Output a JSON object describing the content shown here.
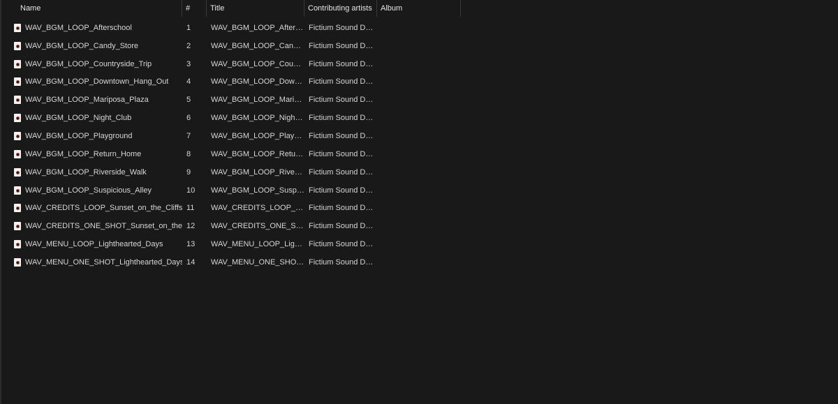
{
  "columns": {
    "name": "Name",
    "num": "#",
    "title": "Title",
    "artist": "Contributing artists",
    "album": "Album"
  },
  "sort_icon": "chevron-up-icon",
  "file_icon": "audio-file-icon",
  "rows": [
    {
      "name": "WAV_BGM_LOOP_Afterschool",
      "num": "1",
      "title": "WAV_BGM_LOOP_Afterschool",
      "artist": "Fictium Sound Design",
      "album": ""
    },
    {
      "name": "WAV_BGM_LOOP_Candy_Store",
      "num": "2",
      "title": "WAV_BGM_LOOP_Candy_Store",
      "artist": "Fictium Sound Design",
      "album": ""
    },
    {
      "name": "WAV_BGM_LOOP_Countryside_Trip",
      "num": "3",
      "title": "WAV_BGM_LOOP_Countryside_Trip",
      "artist": "Fictium Sound Design",
      "album": ""
    },
    {
      "name": "WAV_BGM_LOOP_Downtown_Hang_Out",
      "num": "4",
      "title": "WAV_BGM_LOOP_Downtown_Hang_Out",
      "artist": "Fictium Sound Design",
      "album": ""
    },
    {
      "name": "WAV_BGM_LOOP_Mariposa_Plaza",
      "num": "5",
      "title": "WAV_BGM_LOOP_Mariposa_Plaza",
      "artist": "Fictium Sound Design",
      "album": ""
    },
    {
      "name": "WAV_BGM_LOOP_Night_Club",
      "num": "6",
      "title": "WAV_BGM_LOOP_Night_Club",
      "artist": "Fictium Sound Design",
      "album": ""
    },
    {
      "name": "WAV_BGM_LOOP_Playground",
      "num": "7",
      "title": "WAV_BGM_LOOP_Playground",
      "artist": "Fictium Sound Design",
      "album": ""
    },
    {
      "name": "WAV_BGM_LOOP_Return_Home",
      "num": "8",
      "title": "WAV_BGM_LOOP_Return_Home",
      "artist": "Fictium Sound Design",
      "album": ""
    },
    {
      "name": "WAV_BGM_LOOP_Riverside_Walk",
      "num": "9",
      "title": "WAV_BGM_LOOP_Riverside_Walk",
      "artist": "Fictium Sound Design",
      "album": ""
    },
    {
      "name": "WAV_BGM_LOOP_Suspicious_Alley",
      "num": "10",
      "title": "WAV_BGM_LOOP_Suspicious_Alley",
      "artist": "Fictium Sound Design",
      "album": ""
    },
    {
      "name": "WAV_CREDITS_LOOP_Sunset_on_the_Cliffs",
      "num": "11",
      "title": "WAV_CREDITS_LOOP_Sunset_on_the_Cliffs",
      "artist": "Fictium Sound Design",
      "album": ""
    },
    {
      "name": "WAV_CREDITS_ONE_SHOT_Sunset_on_the_Cliffs",
      "num": "12",
      "title": "WAV_CREDITS_ONE_SHOT_Sunset_on_the_Cliffs",
      "artist": "Fictium Sound Design",
      "album": ""
    },
    {
      "name": "WAV_MENU_LOOP_Lighthearted_Days",
      "num": "13",
      "title": "WAV_MENU_LOOP_Lighthearted_Days",
      "artist": "Fictium Sound Design",
      "album": ""
    },
    {
      "name": "WAV_MENU_ONE_SHOT_Lighthearted_Days",
      "num": "14",
      "title": "WAV_MENU_ONE_SHOT_Lighthearted_Days",
      "artist": "Fictium Sound Design",
      "album": ""
    }
  ]
}
